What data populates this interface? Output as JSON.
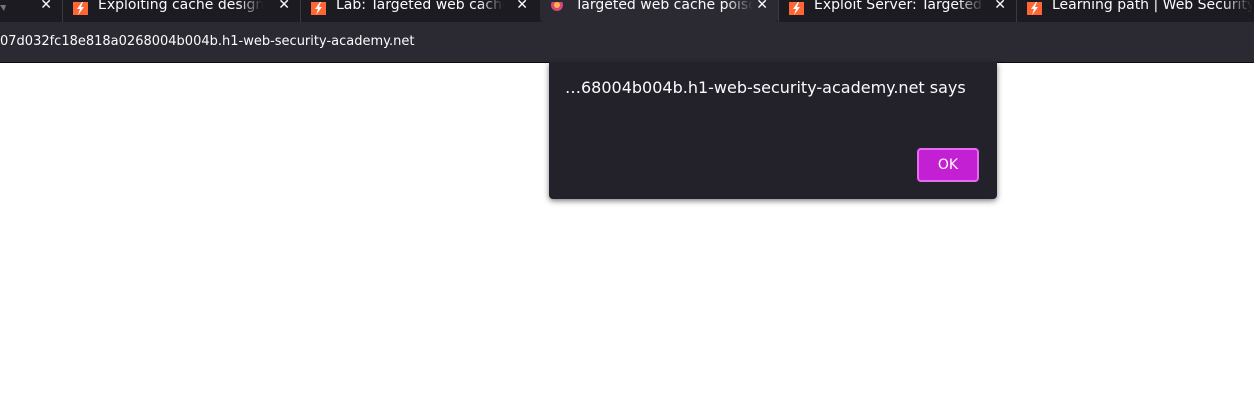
{
  "browser": {
    "tabs": [
      {
        "title": "",
        "icon": "speaker-icon",
        "active": false
      },
      {
        "title": "Exploiting cache design flaws",
        "icon": "burp-lightning-icon",
        "active": false
      },
      {
        "title": "Lab: Targeted web cache poisoning",
        "icon": "burp-lightning-icon",
        "active": false
      },
      {
        "title": "Targeted web cache poisoning",
        "icon": "lab-flask-icon",
        "active": true
      },
      {
        "title": "Exploit Server: Targeted web cache poisoning",
        "icon": "burp-lightning-icon",
        "active": false
      },
      {
        "title": "Learning path | Web Security Academy",
        "icon": "burp-lightning-icon",
        "active": false
      }
    ],
    "close_glyph": "✕",
    "url": "07d032fc18e818a0268004b004b.h1-web-security-academy.net"
  },
  "dialog": {
    "message": "…68004b004b.h1-web-security-academy.net says",
    "ok_label": "OK"
  },
  "colors": {
    "tabbar_bg": "#1c1b22",
    "toolbar_bg": "#2b2a33",
    "dialog_bg": "#23222b",
    "accent_button": "#c31fd3",
    "burp_orange": "#ff6633"
  }
}
